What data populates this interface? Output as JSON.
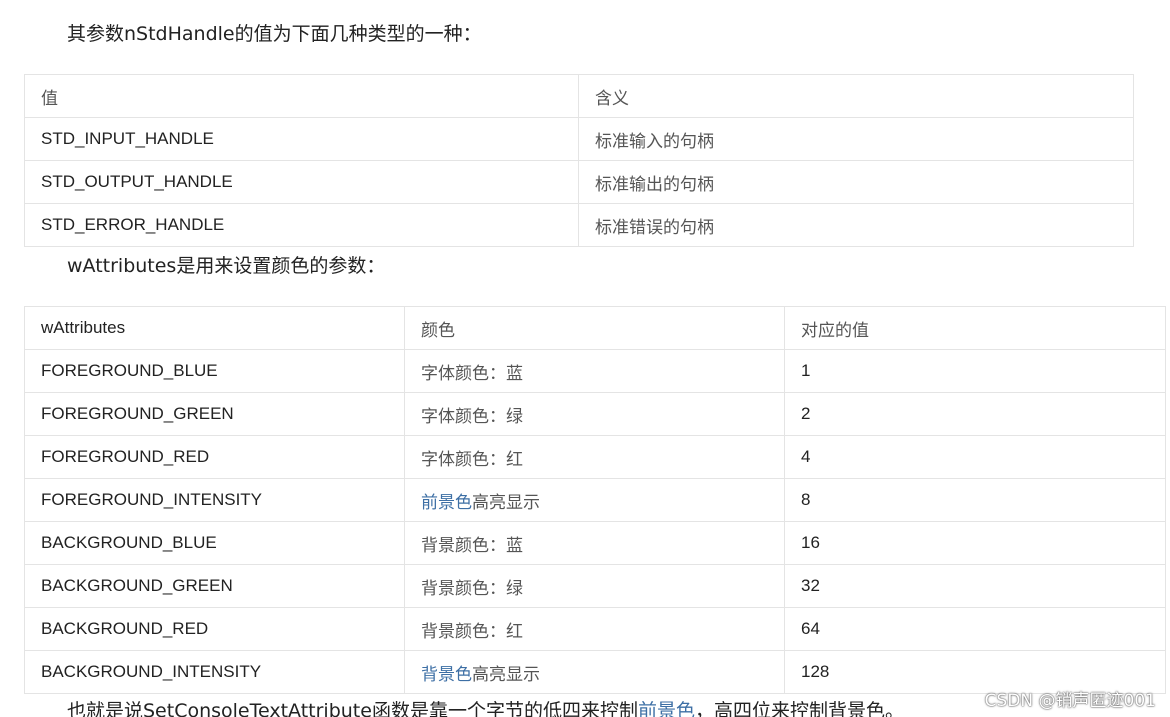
{
  "intro_text": "其参数nStdHandle的值为下面几种类型的一种：",
  "table1": {
    "headers": [
      "值",
      "含义"
    ],
    "rows": [
      {
        "value": "STD_INPUT_HANDLE",
        "meaning": "标准输入的句柄"
      },
      {
        "value": "STD_OUTPUT_HANDLE",
        "meaning": "标准输出的句柄"
      },
      {
        "value": "STD_ERROR_HANDLE",
        "meaning": "标准错误的句柄"
      }
    ]
  },
  "attributes_text": "wAttributes是用来设置颜色的参数：",
  "table2": {
    "headers": [
      "wAttributes",
      "颜色",
      "对应的值"
    ],
    "rows": [
      {
        "name": "FOREGROUND_BLUE",
        "color_link": "",
        "color": "字体颜色：蓝",
        "value": "1"
      },
      {
        "name": "FOREGROUND_GREEN",
        "color_link": "",
        "color": "字体颜色：绿",
        "value": "2"
      },
      {
        "name": "FOREGROUND_RED",
        "color_link": "",
        "color": "字体颜色：红",
        "value": "4"
      },
      {
        "name": "FOREGROUND_INTENSITY",
        "color_link": "前景色",
        "color": "高亮显示",
        "value": "8"
      },
      {
        "name": "BACKGROUND_BLUE",
        "color_link": "",
        "color": "背景颜色：蓝",
        "value": "16"
      },
      {
        "name": "BACKGROUND_GREEN",
        "color_link": "",
        "color": "背景颜色：绿",
        "value": "32"
      },
      {
        "name": "BACKGROUND_RED",
        "color_link": "",
        "color": "背景颜色：红",
        "value": "64"
      },
      {
        "name": "BACKGROUND_INTENSITY",
        "color_link": "背景色",
        "color": "高亮显示",
        "value": "128"
      }
    ]
  },
  "bottom_text": {
    "before": "也就是说SetConsoleTextAttribute函数是靠一个字节的低四来控制",
    "link": "前景色",
    "after": "，高四位来控制背景色。"
  },
  "watermark": "CSDN @销声匿迹001",
  "colors": {
    "link": "#3d6fa5",
    "border": "#e4e4e4",
    "text": "#222222"
  }
}
